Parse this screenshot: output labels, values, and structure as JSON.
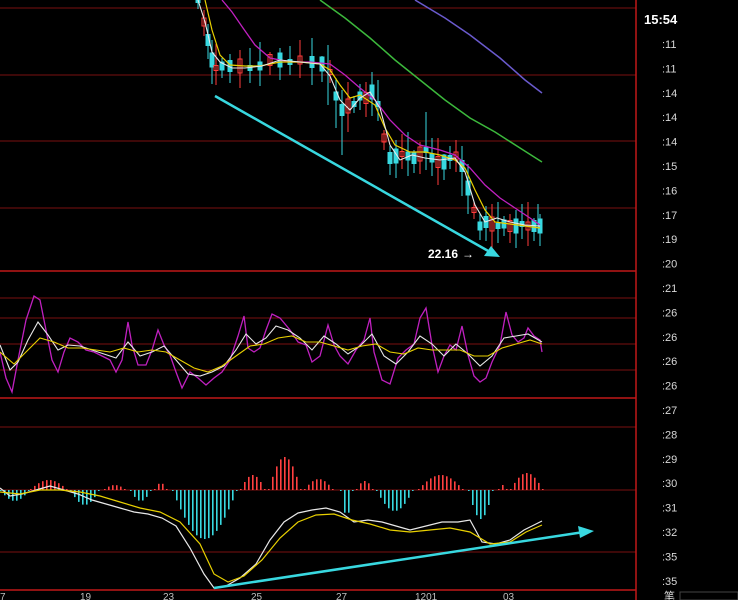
{
  "panel": {
    "clock": "15:54",
    "side_entries": [
      ":11",
      ":11",
      ":14",
      ":14",
      ":14",
      ":15",
      ":16",
      ":17",
      ":19",
      ":20",
      ":21",
      ":26",
      ":26",
      ":26",
      ":26",
      ":27",
      ":28",
      ":29",
      ":30",
      ":31",
      ":32",
      ":35",
      ":35"
    ],
    "bottom_label": "笔"
  },
  "annotation": {
    "price_label": "22.16"
  },
  "chart_data": [
    {
      "type": "candlestick",
      "panel": "price",
      "x_tick_labels": [
        "7",
        "19",
        "23",
        "25",
        "27",
        "1201",
        "03"
      ],
      "low_marker": "22.16",
      "trendline": "descending cyan line from upper-left swing low to the lowest low, with arrowhead",
      "colors": {
        "up": "#ff3b3b",
        "down": "#38d8e0",
        "ma_short": "#e8e8e8",
        "ma_mid": "#e8d000",
        "ma_long": "#c020c0",
        "ma_60": "#3cb83c",
        "ma_120": "#6a5acd"
      }
    },
    {
      "type": "line",
      "panel": "oscillator",
      "series_colors": [
        "#c020c0",
        "#e8e8e8",
        "#e8d000"
      ]
    },
    {
      "type": "bar",
      "panel": "macd",
      "histogram_colors": {
        "positive": "#ff4040",
        "negative": "#38d8e0"
      },
      "line_colors": [
        "#e8e8e8",
        "#e8d000"
      ],
      "trendline": "ascending cyan line from lowest point to the right edge, with arrowhead"
    }
  ]
}
